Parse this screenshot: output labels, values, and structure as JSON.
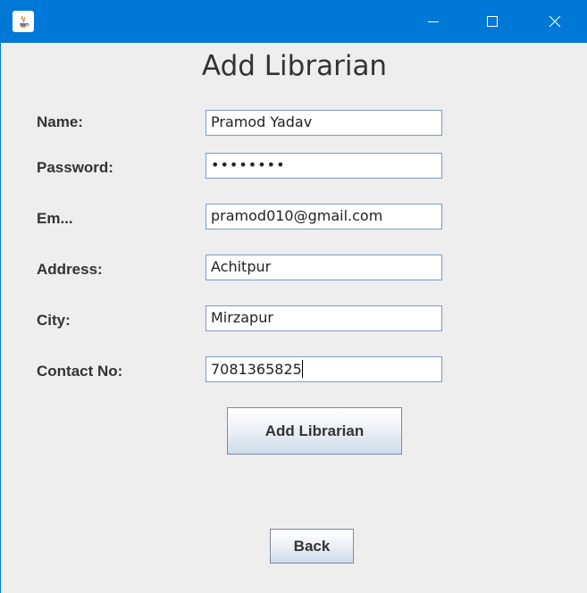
{
  "window": {
    "title": "",
    "app_icon": "java-icon",
    "controls": {
      "minimize_icon": "minimize-icon",
      "maximize_icon": "maximize-icon",
      "close_icon": "close-icon"
    }
  },
  "form": {
    "heading": "Add Librarian",
    "fields": {
      "name": {
        "label": "Name:",
        "value": "Pramod Yadav"
      },
      "password": {
        "label": "Password:",
        "value": "••••••••"
      },
      "email": {
        "label": "Em...",
        "value": "pramod010@gmail.com"
      },
      "address": {
        "label": "Address:",
        "value": "Achitpur"
      },
      "city": {
        "label": "City:",
        "value": "Mirzapur"
      },
      "contact": {
        "label": "Contact No:",
        "value": "7081365825"
      }
    },
    "add_button_label": "Add Librarian",
    "back_button_label": "Back"
  },
  "colors": {
    "titlebar": "#0078d7",
    "background": "#eeeeee",
    "field_border": "#7a9cc6"
  }
}
